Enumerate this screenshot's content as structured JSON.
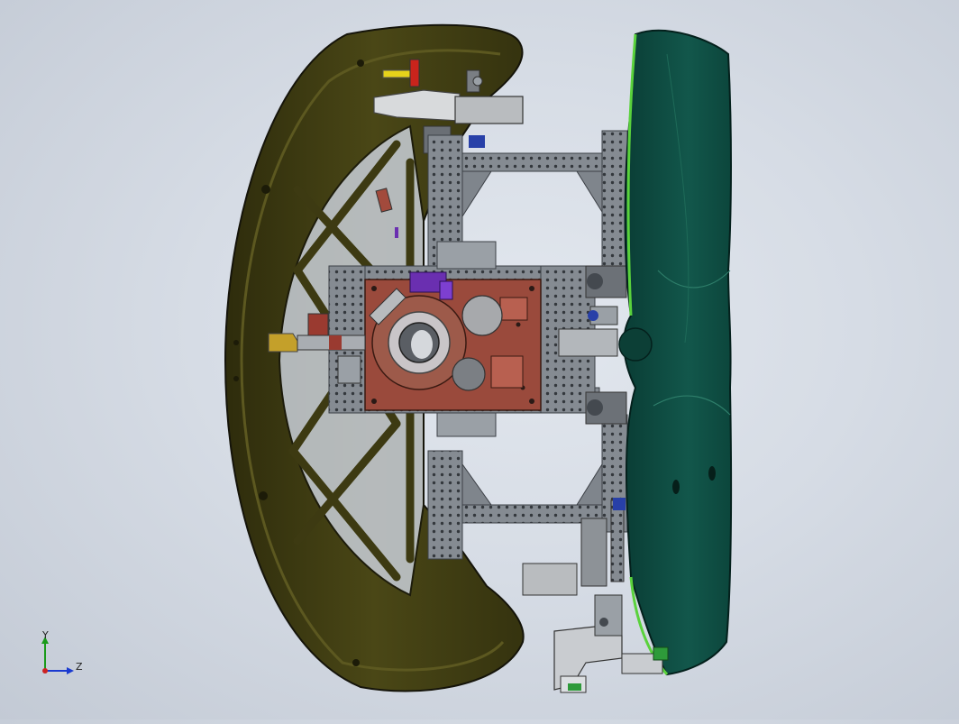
{
  "viewport": {
    "model": "steering-wheel-fixture-assembly",
    "view_orientation": "side"
  },
  "triad": {
    "y_label": "Y",
    "z_label": "Z"
  },
  "colors": {
    "background_center": "#e2e7ee",
    "background_edge": "#c3cad5",
    "wheel_rim": "#3d3a12",
    "wheel_edge": "#1a1906",
    "airbag_cover": "#0d4a40",
    "airbag_edge": "#5ad23c",
    "frame_steel": "#8c9298",
    "mount_plate": "#9a4a3c",
    "clamp_purple": "#6a2fb0",
    "axis_y": "#1a9a1a",
    "axis_z": "#1a3ad0"
  }
}
